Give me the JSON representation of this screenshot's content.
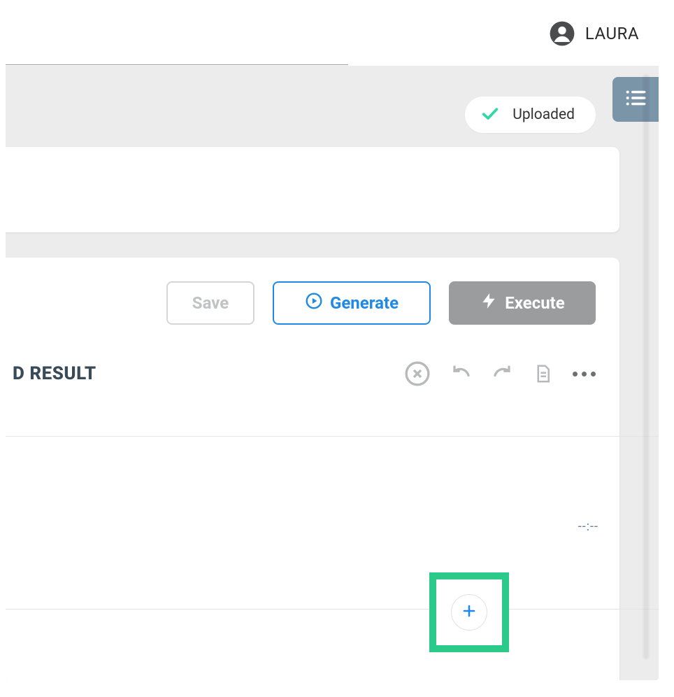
{
  "header": {
    "username": "LAURA"
  },
  "status": {
    "label": "Uploaded"
  },
  "actions": {
    "save_label": "Save",
    "generate_label": "Generate",
    "execute_label": "Execute"
  },
  "section": {
    "title_fragment": "D RESULT"
  },
  "timeline": {
    "timecode": "--:--"
  },
  "colors": {
    "accent_blue": "#1f89e5",
    "accent_green": "#2bca8b",
    "side_button": "#7a94a8",
    "execute_grey": "#9a9c9e",
    "check_green": "#2fd8a6"
  }
}
